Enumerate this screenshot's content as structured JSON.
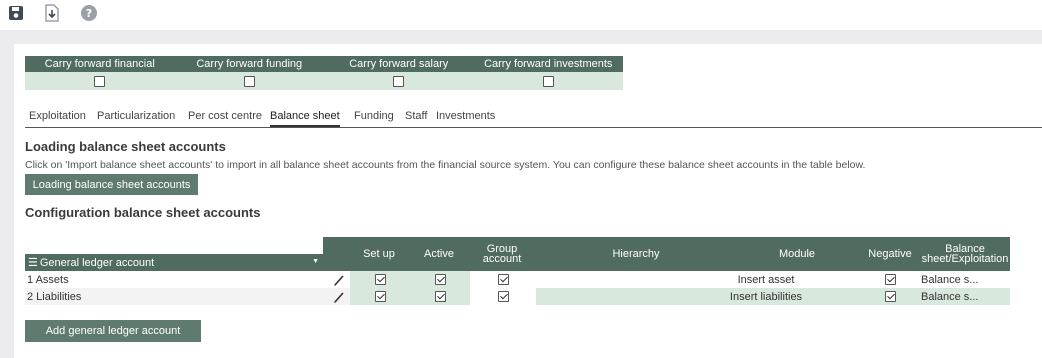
{
  "toolbar": {
    "icons": [
      "save-icon",
      "download-icon",
      "help-icon"
    ],
    "help_glyph": "?"
  },
  "carry_forward": {
    "columns": [
      {
        "label": "Carry forward financial",
        "checked": false
      },
      {
        "label": "Carry forward funding",
        "checked": false
      },
      {
        "label": "Carry forward salary",
        "checked": false
      },
      {
        "label": "Carry forward investments",
        "checked": false
      }
    ]
  },
  "tabs": [
    {
      "label": "Exploitation",
      "active": false
    },
    {
      "label": "Particularization",
      "active": false
    },
    {
      "label": "Per cost centre",
      "active": false
    },
    {
      "label": "Balance sheet",
      "active": true
    },
    {
      "label": "Funding",
      "active": false
    },
    {
      "label": "Staff",
      "active": false
    },
    {
      "label": "Investments",
      "active": false
    }
  ],
  "loading": {
    "title": "Loading balance sheet accounts",
    "description": "Click on 'Import balance sheet accounts' to import in all balance sheet accounts from the financial source system. You can configure these balance sheet accounts in the table below.",
    "button_label": "Loading balance sheet accounts"
  },
  "configuration": {
    "title": "Configuration balance sheet accounts",
    "gla_header": "General ledger account",
    "headers": {
      "setup": "Set up",
      "active": "Active",
      "group_account_1": "Group",
      "group_account_2": "account",
      "hierarchy": "Hierarchy",
      "module": "Module",
      "negative": "Negative",
      "bs_1": "Balance",
      "bs_2": "sheet/Exploitation"
    },
    "rows": [
      {
        "account": "1 Assets",
        "setup": true,
        "active": true,
        "group_account": true,
        "hierarchy": "",
        "module": "Insert asset",
        "negative": true,
        "balance_sheet": "Balance s..."
      },
      {
        "account": "2 Liabilities",
        "setup": true,
        "active": true,
        "group_account": true,
        "hierarchy": "",
        "module": "Insert liabilities",
        "negative": true,
        "balance_sheet": "Balance s..."
      }
    ],
    "add_button_label": "Add general ledger account"
  },
  "colors": {
    "header_green": "#506b60",
    "button_green": "#5f7b70",
    "row_tint": "#d9e8dd",
    "band_gray": "#ececef"
  }
}
